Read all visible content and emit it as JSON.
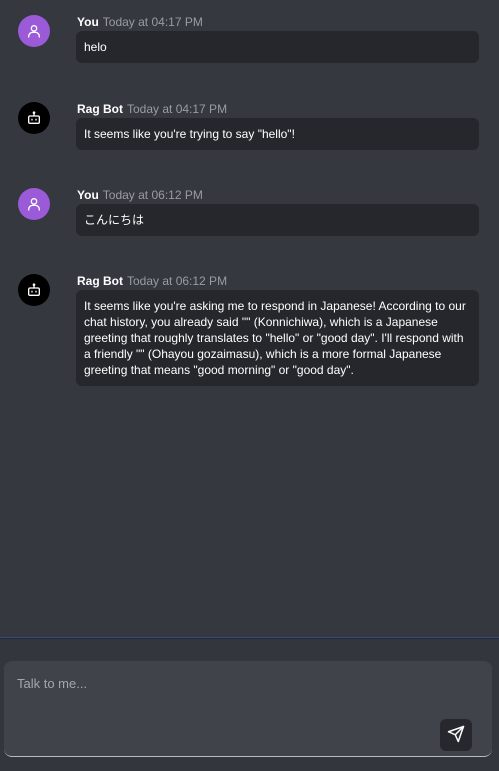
{
  "messages": [
    {
      "author": "You",
      "time": "Today at 04:17 PM",
      "text": "helo",
      "avatar_icon": "user-icon"
    },
    {
      "author": "Rag Bot",
      "time": "Today at 04:17 PM",
      "text": "It seems like you're trying to say \"hello\"!",
      "avatar_icon": "bot-icon"
    },
    {
      "author": "You",
      "time": "Today at 06:12 PM",
      "text": "こんにちは",
      "avatar_icon": "user-icon"
    },
    {
      "author": "Rag Bot",
      "time": "Today at 06:12 PM",
      "text": "It seems like you're asking me to respond in Japanese! According to our chat history, you already said \"\" (Konnichiwa), which is a Japanese greeting that roughly translates to \"hello\" or \"good day\". I'll respond with a friendly \"\" (Ohayou gozaimasu), which is a more formal Japanese greeting that means \"good morning\" or \"good day\".",
      "avatar_icon": "bot-icon"
    }
  ],
  "composer": {
    "placeholder": "Talk to me...",
    "value": "",
    "send_icon": "send-icon"
  },
  "colors": {
    "background": "#363840",
    "bubble": "#25272c",
    "user_avatar": "#9b5bd9",
    "bot_avatar": "#000000",
    "timestamp": "#9a9ca4"
  }
}
